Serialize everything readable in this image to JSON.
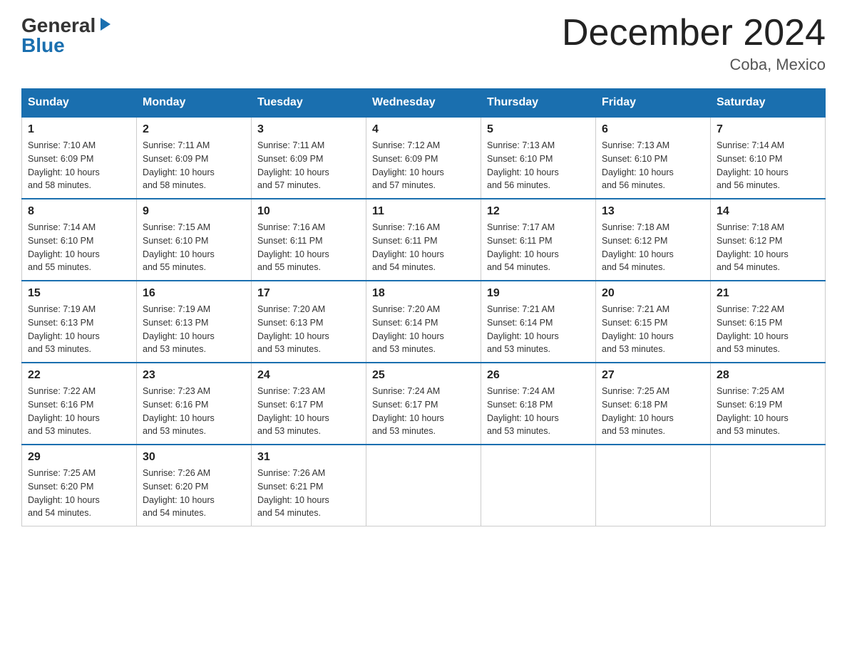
{
  "header": {
    "logo_general": "General",
    "logo_blue": "Blue",
    "title": "December 2024",
    "location": "Coba, Mexico"
  },
  "days_of_week": [
    "Sunday",
    "Monday",
    "Tuesday",
    "Wednesday",
    "Thursday",
    "Friday",
    "Saturday"
  ],
  "weeks": [
    [
      {
        "day": "1",
        "sunrise": "7:10 AM",
        "sunset": "6:09 PM",
        "daylight": "10 hours and 58 minutes."
      },
      {
        "day": "2",
        "sunrise": "7:11 AM",
        "sunset": "6:09 PM",
        "daylight": "10 hours and 58 minutes."
      },
      {
        "day": "3",
        "sunrise": "7:11 AM",
        "sunset": "6:09 PM",
        "daylight": "10 hours and 57 minutes."
      },
      {
        "day": "4",
        "sunrise": "7:12 AM",
        "sunset": "6:09 PM",
        "daylight": "10 hours and 57 minutes."
      },
      {
        "day": "5",
        "sunrise": "7:13 AM",
        "sunset": "6:10 PM",
        "daylight": "10 hours and 56 minutes."
      },
      {
        "day": "6",
        "sunrise": "7:13 AM",
        "sunset": "6:10 PM",
        "daylight": "10 hours and 56 minutes."
      },
      {
        "day": "7",
        "sunrise": "7:14 AM",
        "sunset": "6:10 PM",
        "daylight": "10 hours and 56 minutes."
      }
    ],
    [
      {
        "day": "8",
        "sunrise": "7:14 AM",
        "sunset": "6:10 PM",
        "daylight": "10 hours and 55 minutes."
      },
      {
        "day": "9",
        "sunrise": "7:15 AM",
        "sunset": "6:10 PM",
        "daylight": "10 hours and 55 minutes."
      },
      {
        "day": "10",
        "sunrise": "7:16 AM",
        "sunset": "6:11 PM",
        "daylight": "10 hours and 55 minutes."
      },
      {
        "day": "11",
        "sunrise": "7:16 AM",
        "sunset": "6:11 PM",
        "daylight": "10 hours and 54 minutes."
      },
      {
        "day": "12",
        "sunrise": "7:17 AM",
        "sunset": "6:11 PM",
        "daylight": "10 hours and 54 minutes."
      },
      {
        "day": "13",
        "sunrise": "7:18 AM",
        "sunset": "6:12 PM",
        "daylight": "10 hours and 54 minutes."
      },
      {
        "day": "14",
        "sunrise": "7:18 AM",
        "sunset": "6:12 PM",
        "daylight": "10 hours and 54 minutes."
      }
    ],
    [
      {
        "day": "15",
        "sunrise": "7:19 AM",
        "sunset": "6:13 PM",
        "daylight": "10 hours and 53 minutes."
      },
      {
        "day": "16",
        "sunrise": "7:19 AM",
        "sunset": "6:13 PM",
        "daylight": "10 hours and 53 minutes."
      },
      {
        "day": "17",
        "sunrise": "7:20 AM",
        "sunset": "6:13 PM",
        "daylight": "10 hours and 53 minutes."
      },
      {
        "day": "18",
        "sunrise": "7:20 AM",
        "sunset": "6:14 PM",
        "daylight": "10 hours and 53 minutes."
      },
      {
        "day": "19",
        "sunrise": "7:21 AM",
        "sunset": "6:14 PM",
        "daylight": "10 hours and 53 minutes."
      },
      {
        "day": "20",
        "sunrise": "7:21 AM",
        "sunset": "6:15 PM",
        "daylight": "10 hours and 53 minutes."
      },
      {
        "day": "21",
        "sunrise": "7:22 AM",
        "sunset": "6:15 PM",
        "daylight": "10 hours and 53 minutes."
      }
    ],
    [
      {
        "day": "22",
        "sunrise": "7:22 AM",
        "sunset": "6:16 PM",
        "daylight": "10 hours and 53 minutes."
      },
      {
        "day": "23",
        "sunrise": "7:23 AM",
        "sunset": "6:16 PM",
        "daylight": "10 hours and 53 minutes."
      },
      {
        "day": "24",
        "sunrise": "7:23 AM",
        "sunset": "6:17 PM",
        "daylight": "10 hours and 53 minutes."
      },
      {
        "day": "25",
        "sunrise": "7:24 AM",
        "sunset": "6:17 PM",
        "daylight": "10 hours and 53 minutes."
      },
      {
        "day": "26",
        "sunrise": "7:24 AM",
        "sunset": "6:18 PM",
        "daylight": "10 hours and 53 minutes."
      },
      {
        "day": "27",
        "sunrise": "7:25 AM",
        "sunset": "6:18 PM",
        "daylight": "10 hours and 53 minutes."
      },
      {
        "day": "28",
        "sunrise": "7:25 AM",
        "sunset": "6:19 PM",
        "daylight": "10 hours and 53 minutes."
      }
    ],
    [
      {
        "day": "29",
        "sunrise": "7:25 AM",
        "sunset": "6:20 PM",
        "daylight": "10 hours and 54 minutes."
      },
      {
        "day": "30",
        "sunrise": "7:26 AM",
        "sunset": "6:20 PM",
        "daylight": "10 hours and 54 minutes."
      },
      {
        "day": "31",
        "sunrise": "7:26 AM",
        "sunset": "6:21 PM",
        "daylight": "10 hours and 54 minutes."
      },
      null,
      null,
      null,
      null
    ]
  ],
  "labels": {
    "sunrise": "Sunrise:",
    "sunset": "Sunset:",
    "daylight": "Daylight:"
  }
}
